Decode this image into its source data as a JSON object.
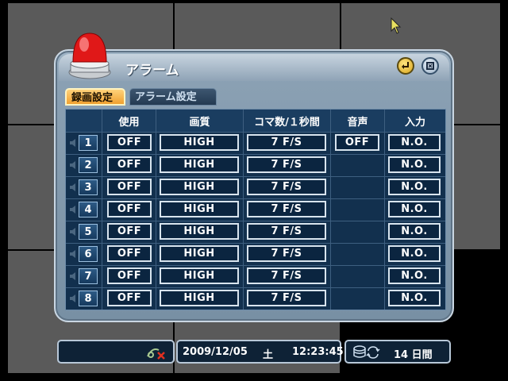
{
  "dialog": {
    "title": "アラーム",
    "icons": {
      "beacon": "red-alarm-beacon-icon",
      "enter": "enter-icon",
      "close": "close-icon"
    }
  },
  "tabs": [
    {
      "label": "録画設定",
      "active": true
    },
    {
      "label": "アラーム設定",
      "active": false
    }
  ],
  "table": {
    "headers": [
      "使用",
      "画質",
      "コマ数/１秒間",
      "音声",
      "入力"
    ],
    "rows": [
      {
        "ch": "1",
        "use": "OFF",
        "quality": "HIGH",
        "fps": "7 F/S",
        "audio": "OFF",
        "input": "N.O."
      },
      {
        "ch": "2",
        "use": "OFF",
        "quality": "HIGH",
        "fps": "7 F/S",
        "audio": "",
        "input": "N.O."
      },
      {
        "ch": "3",
        "use": "OFF",
        "quality": "HIGH",
        "fps": "7 F/S",
        "audio": "",
        "input": "N.O."
      },
      {
        "ch": "4",
        "use": "OFF",
        "quality": "HIGH",
        "fps": "7 F/S",
        "audio": "",
        "input": "N.O."
      },
      {
        "ch": "5",
        "use": "OFF",
        "quality": "HIGH",
        "fps": "7 F/S",
        "audio": "",
        "input": "N.O."
      },
      {
        "ch": "6",
        "use": "OFF",
        "quality": "HIGH",
        "fps": "7 F/S",
        "audio": "",
        "input": "N.O."
      },
      {
        "ch": "7",
        "use": "OFF",
        "quality": "HIGH",
        "fps": "7 F/S",
        "audio": "",
        "input": "N.O."
      },
      {
        "ch": "8",
        "use": "OFF",
        "quality": "HIGH",
        "fps": "7 F/S",
        "audio": "",
        "input": "N.O."
      }
    ]
  },
  "status": {
    "date": "2009/12/05",
    "weekday": "土",
    "time": "12:23:45",
    "remaining": "14 日間",
    "icons": {
      "network": "network-disconnected-icon",
      "disk": "disk-overwrite-icon"
    }
  },
  "colors": {
    "accent": "#f0a030",
    "panel": "#8aa0b3",
    "table_bg": "#12304e"
  }
}
